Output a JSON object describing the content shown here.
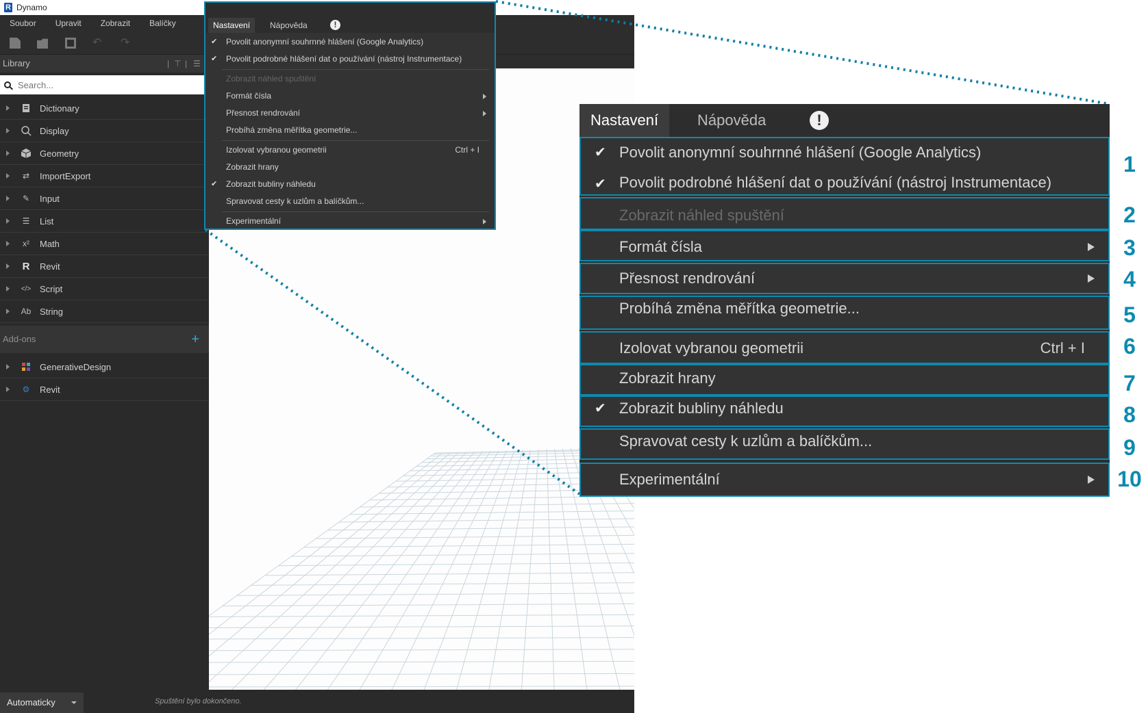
{
  "app": {
    "title": "Dynamo"
  },
  "menubar": {
    "items": [
      "Soubor",
      "Upravit",
      "Zobrazit",
      "Balíčky",
      "Nastavení",
      "Nápověda"
    ],
    "active": "Nastavení"
  },
  "library": {
    "header": "Library",
    "search_placeholder": "Search...",
    "items": [
      {
        "label": "Dictionary",
        "icon": "dictionary-icon"
      },
      {
        "label": "Display",
        "icon": "magnifier-icon"
      },
      {
        "label": "Geometry",
        "icon": "cube-icon"
      },
      {
        "label": "ImportExport",
        "icon": "arrows-icon"
      },
      {
        "label": "Input",
        "icon": "pencil-icon"
      },
      {
        "label": "List",
        "icon": "list-icon"
      },
      {
        "label": "Math",
        "icon": "x-squared-icon",
        "glyph": "x²"
      },
      {
        "label": "Revit",
        "icon": "revit-r-icon",
        "glyph": "R"
      },
      {
        "label": "Script",
        "icon": "code-icon",
        "glyph": "</>"
      },
      {
        "label": "String",
        "icon": "ab-icon",
        "glyph": "Ab"
      }
    ],
    "addons_header": "Add-ons",
    "addons": [
      {
        "label": "GenerativeDesign",
        "icon": "generative-design-icon"
      },
      {
        "label": "Revit",
        "icon": "revit-package-icon"
      }
    ]
  },
  "statusbar": {
    "run_mode": "Automaticky",
    "status_text": "Spuštění bylo dokončeno."
  },
  "settings_menu": {
    "header_active": "Nastavení",
    "header_other": "Nápověda",
    "items": [
      {
        "label": "Povolit anonymní souhrnné hlášení (Google Analytics)",
        "checked": true
      },
      {
        "label": "Povolit podrobné hlášení dat o používání (nástroj Instrumentace)",
        "checked": true
      },
      {
        "label": "Zobrazit náhled spuštění",
        "disabled": true
      },
      {
        "label": "Formát čísla",
        "submenu": true
      },
      {
        "label": "Přesnost rendrování",
        "submenu": true
      },
      {
        "label": "Probíhá změna měřítka geometrie..."
      },
      {
        "label": "Izolovat vybranou geometrii",
        "shortcut": "Ctrl + I"
      },
      {
        "label": "Zobrazit hrany"
      },
      {
        "label": "Zobrazit bubliny náhledu",
        "checked": true
      },
      {
        "label": "Spravovat cesty k uzlům a balíčkům..."
      },
      {
        "label": "Experimentální",
        "submenu": true
      }
    ]
  },
  "callouts": [
    "1",
    "2",
    "3",
    "4",
    "5",
    "6",
    "7",
    "8",
    "9",
    "10"
  ],
  "colors": {
    "accent": "#0e8ab0",
    "panel": "#2d2d2d"
  }
}
